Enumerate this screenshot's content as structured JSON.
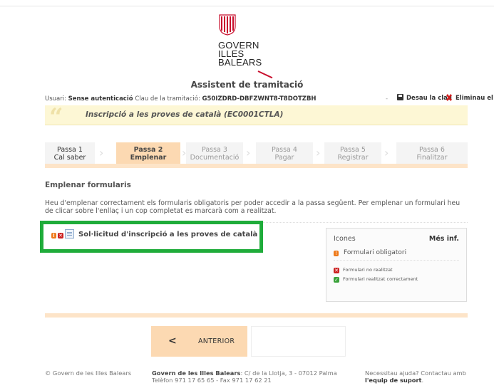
{
  "logo": {
    "line1": "GOVERN",
    "line2": "ILLES",
    "line3": "BALEARS"
  },
  "app_title": "Assistent de tramitació",
  "userbar": {
    "user_label": "Usuari:",
    "user_value": "Sense autenticació",
    "key_label": "Clau de la tramitació:",
    "key_value": "G50IZDRD-DBFZWNT8-T8DOTZBH",
    "separator": "-",
    "save_label": "Desau la clau",
    "delete_label": "Eliminau el tràmit"
  },
  "procedure": {
    "quote": "“",
    "title": "Inscripció a les proves de català (EC0001CTLA)"
  },
  "steps": [
    {
      "line1": "Passa 1",
      "line2": "Cal saber"
    },
    {
      "line1": "Passa 2",
      "line2": "Emplenar"
    },
    {
      "line1": "Passa 3",
      "line2": "Documentació"
    },
    {
      "line1": "Passa 4",
      "line2": "Pagar"
    },
    {
      "line1": "Passa 5",
      "line2": "Registrar"
    },
    {
      "line1": "Passa 6",
      "line2": "Finalitzar"
    }
  ],
  "section": {
    "title": "Emplenar formularis",
    "intro": "Heu d'emplenar correctament els formularis obligatoris per poder accedir a la passa següent. Per emplenar un formulari heu de clicar sobre l'enllaç i un cop completat es marcarà com a realitzat."
  },
  "forms": [
    {
      "label": "Sol·licitud d'inscripció a les proves de català"
    }
  ],
  "legend": {
    "title": "Icones",
    "more": "Més inf.",
    "mandatory": "Formulari obligatori",
    "not_done": "Formulari no realitzat",
    "done": "Formulari realitzat correctament"
  },
  "nav": {
    "prev_arrow": "<",
    "prev_label": "ANTERIOR"
  },
  "footer": {
    "copyright": "© Govern de les Illes Balears",
    "address_bold": "Govern de les Illes Balears",
    "address_rest": ": C/ de la Llotja, 3 - 07012 Palma",
    "phones": "Telèfon 971 17 65 65 - Fax 971 17 62 21",
    "help_text": "Necessitau ajuda? Contactau amb",
    "help_link": "l'equip de suport",
    "help_end": "."
  },
  "colors": {
    "accent": "#fcd9b2",
    "accent_bar": "#fde4c8",
    "procedure_bg": "#fdf7d5",
    "highlight_border": "#1fac3a",
    "mandatory": "#ee7a1a",
    "error": "#cc2222",
    "ok": "#3aa23a"
  }
}
